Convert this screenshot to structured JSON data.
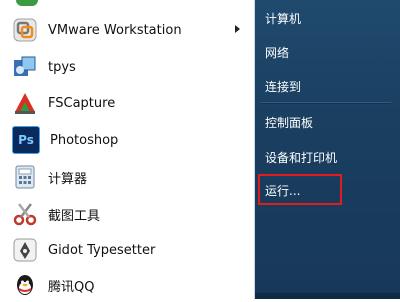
{
  "programs": [
    {
      "label": "VMware Workstation",
      "icon": "vmware-icon",
      "has_submenu": true
    },
    {
      "label": "tpys",
      "icon": "tpys-icon"
    },
    {
      "label": "FSCapture",
      "icon": "fscapture-icon"
    },
    {
      "label": "Photoshop",
      "icon": "photoshop-icon",
      "icon_text": "Ps"
    },
    {
      "label": "计算器",
      "icon": "calculator-icon"
    },
    {
      "label": "截图工具",
      "icon": "snipping-tool-icon"
    },
    {
      "label": "Gidot Typesetter",
      "icon": "gidot-typesetter-icon"
    },
    {
      "label": "腾讯QQ",
      "icon": "qq-icon"
    }
  ],
  "places": [
    {
      "label": "计算机"
    },
    {
      "label": "网络"
    },
    {
      "label": "连接到"
    },
    {
      "label": "控制面板"
    },
    {
      "label": "设备和打印机"
    },
    {
      "label": "运行..."
    }
  ],
  "colors": {
    "right_pane": "#1f4a6e",
    "highlight": "#e21b1b",
    "photoshop": "#0a2a5c"
  }
}
